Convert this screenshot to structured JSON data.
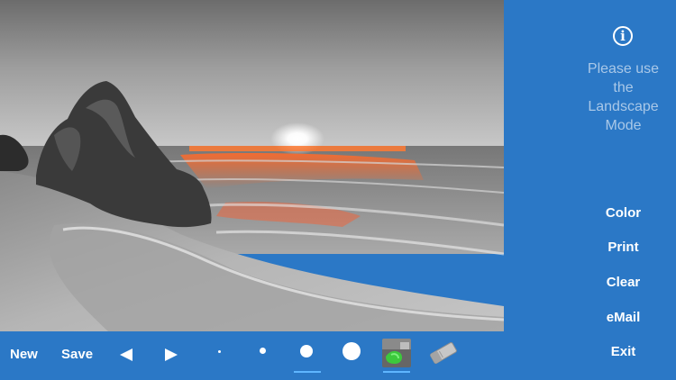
{
  "side_panel": {
    "info_icon": "info-icon",
    "notice": "Please use the Landscape Mode",
    "buttons": {
      "color": "Color",
      "print": "Print",
      "clear": "Clear",
      "email": "eMail",
      "exit": "Exit"
    }
  },
  "toolbar": {
    "new_label": "New",
    "save_label": "Save",
    "undo_icon": "triangle-left-icon",
    "redo_icon": "triangle-right-icon",
    "brush_sizes": [
      "brush-size-tiny",
      "brush-size-small",
      "brush-size-medium",
      "brush-size-large"
    ],
    "selected_brush": "brush-size-medium",
    "color_brush_icon": "color-brush-thumbnail",
    "eraser_icon": "eraser-icon",
    "selected_tool": "color-brush"
  },
  "colors": {
    "panel": "#2b78c6",
    "accent_underline": "#5fb6ff",
    "notice_text": "#a9c8e8"
  }
}
